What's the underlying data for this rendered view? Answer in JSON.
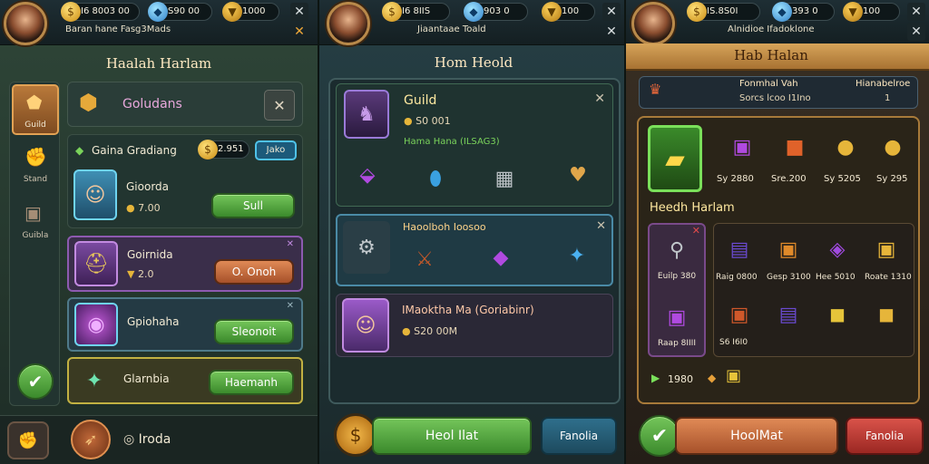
{
  "panel1": {
    "resources": {
      "coins": "I6 8003 00",
      "gems": "S90 00",
      "trophies": "1000"
    },
    "subtitle": "Baran hane Fasg3Mads",
    "title": "Haalah Harlam",
    "sidebar": [
      {
        "label": "Guild"
      },
      {
        "label": "Stand"
      },
      {
        "label": "Guibla"
      }
    ],
    "header_label": "Goludans",
    "list_heading": "Gaina Gradiang",
    "heading_price": "2.951",
    "heading_chip": "Jako",
    "items": [
      {
        "name": "Gioorda",
        "price": "7.00",
        "button": "Sull",
        "color": "green"
      },
      {
        "name": "Goirnida",
        "price": "2.0",
        "button": "O. Onoh",
        "color": "orange"
      },
      {
        "name": "Gpiohaha",
        "price": "",
        "button": "Sleonoit",
        "color": "green"
      },
      {
        "name": "Glarnbia",
        "price": "",
        "button": "Haemanh",
        "color": "green"
      }
    ],
    "bottom_label": "Iroda"
  },
  "panel2": {
    "resources": {
      "coins": "I6 8IIS",
      "gems": "903 0",
      "trophies": "100"
    },
    "subtitle": "Jiaantaae Toald",
    "title": "Hom Heold",
    "guild_title": "Guild",
    "guild_price": "S0 001",
    "guild_sub": "Hama Hana (ILSAG3)",
    "card2_title": "Haoolboh Ioosoo",
    "card3_title": "IMaoktha Ma (Goriabinr)",
    "card3_price": "S20 00M",
    "btn_primary": "Heol Ilat",
    "btn_secondary": "Fanolia"
  },
  "panel3": {
    "resources": {
      "coins": "IS.8S0I",
      "gems": "393 0",
      "trophies": "100"
    },
    "subtitle": "Alnidioe Ifadoklone",
    "title": "Hab Halan",
    "info_left": "Fonmhal Vah",
    "info_left_sub": "Sorcs lcoo I1Ino",
    "info_right": "Hianabelroe",
    "info_right_sub": "1",
    "top_prices": [
      "",
      "Sy 2880",
      "Sre.200",
      "Sy 5205",
      "Sy 295"
    ],
    "section_title": "Heedh Harlam",
    "side_price": "Euilp 380",
    "grid_prices": [
      "Raig 0800",
      "Gesp 3100",
      "Hee 5010",
      "Roate 1310"
    ],
    "row3_prices": [
      "Raap 8IIII",
      "S6 I6I0",
      "",
      "",
      ""
    ],
    "bottom_price": "1980",
    "btn_primary": "HoolMat",
    "btn_secondary": "Fanolia"
  }
}
